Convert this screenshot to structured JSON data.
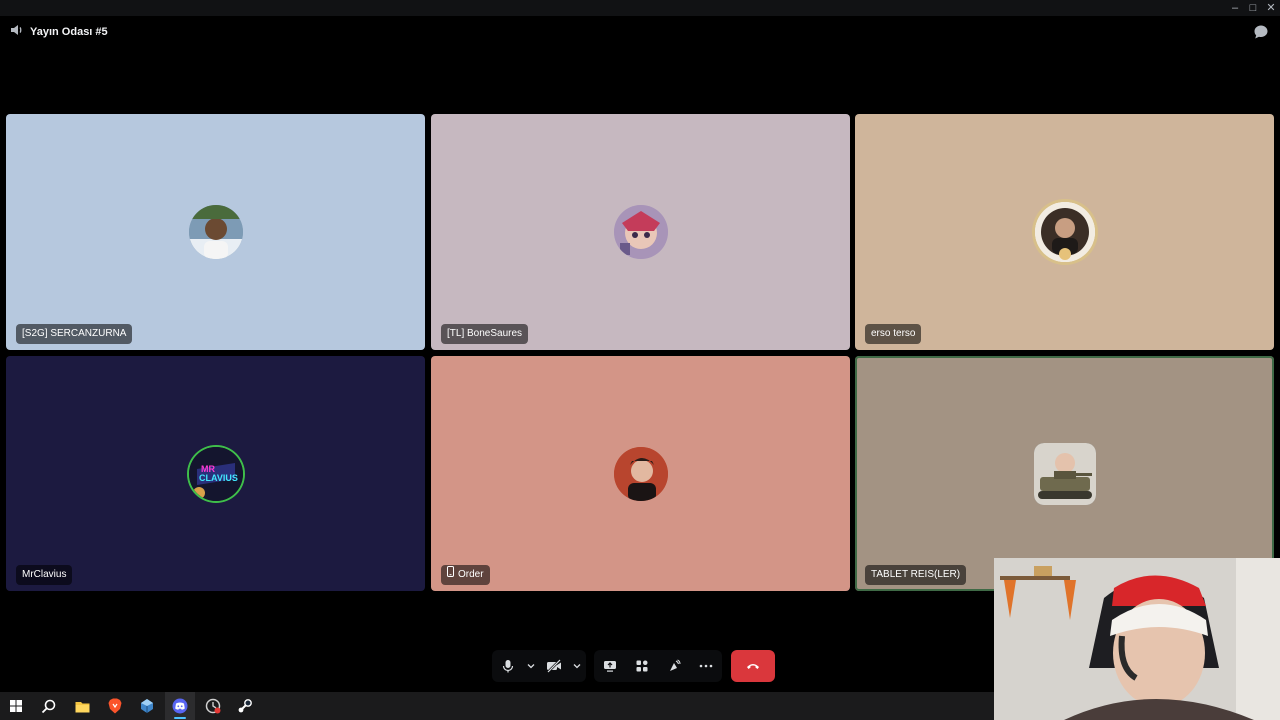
{
  "window": {
    "controls": {
      "minimize": "–",
      "maximize": "□",
      "close": "✕"
    }
  },
  "channel": {
    "name": "Yayın Odası #5",
    "icon": "speaker-icon"
  },
  "participants": [
    {
      "name": "[S2G] SERCANZURNA",
      "tile_color": "#b6c8de",
      "avatar": "photo-avatar",
      "mobile": false,
      "speaking": false
    },
    {
      "name": "[TL] BoneSaures",
      "tile_color": "#c6b8c0",
      "avatar": "character-art-avatar",
      "mobile": false,
      "speaking": false
    },
    {
      "name": "erso terso",
      "tile_color": "#cfb59b",
      "avatar": "framed-photo-avatar",
      "mobile": false,
      "speaking": false
    },
    {
      "name": "MrClavius",
      "tile_color": "#1c1a40",
      "avatar": "neon-logo-avatar",
      "mobile": false,
      "speaking": false
    },
    {
      "name": "Order",
      "tile_color": "#d39587",
      "avatar": "photo-avatar",
      "mobile": true,
      "speaking": false
    },
    {
      "name": "TABLET REIS(LER)",
      "tile_color": "#a39383",
      "avatar": "tank-photo-avatar",
      "mobile": false,
      "speaking": true
    }
  ],
  "controls": {
    "group1": [
      "microphone-icon",
      "chevron-down-icon",
      "camera-off-icon",
      "chevron-down-icon"
    ],
    "group2": [
      "screen-share-icon",
      "activities-icon",
      "soundboard-icon",
      "more-icon"
    ],
    "hangup": "hang-up-icon",
    "hangup_color": "#da373c"
  },
  "taskbar": {
    "items": [
      "windows-start-icon",
      "search-icon",
      "file-explorer-icon",
      "brave-browser-icon",
      "app-icon",
      "discord-icon",
      "app-icon-2",
      "steam-icon"
    ],
    "active": "discord-icon"
  },
  "webcam": {
    "label": "streamer-webcam-overlay"
  }
}
